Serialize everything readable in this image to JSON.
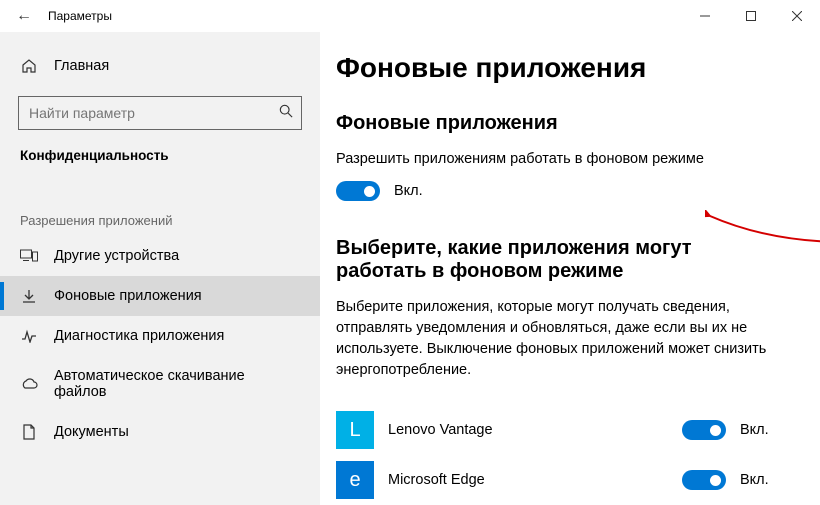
{
  "window": {
    "title": "Параметры"
  },
  "sidebar": {
    "home": "Главная",
    "search_placeholder": "Найти параметр",
    "subheader": "Конфиденциальность",
    "section_label": "Разрешения приложений",
    "items": [
      {
        "label": "Другие устройства"
      },
      {
        "label": "Фоновые приложения"
      },
      {
        "label": "Диагностика приложения"
      },
      {
        "label": "Автоматическое скачивание файлов"
      },
      {
        "label": "Документы"
      }
    ]
  },
  "main": {
    "h1": "Фоновые приложения",
    "h2a": "Фоновые приложения",
    "allow_text": "Разрешить приложениям работать в фоновом режиме",
    "master_state": "Вкл.",
    "h2b": "Выберите, какие приложения могут работать в фоновом режиме",
    "para": "Выберите приложения, которые могут получать сведения, отправлять уведомления и обновляться, даже если вы их не используете. Выключение фоновых приложений может снизить энергопотребление.",
    "apps": [
      {
        "name": "Lenovo Vantage",
        "letter": "L",
        "color": "#00b0e6",
        "state": "Вкл."
      },
      {
        "name": "Microsoft Edge",
        "letter": "e",
        "color": "#0078d4",
        "state": "Вкл."
      }
    ]
  }
}
